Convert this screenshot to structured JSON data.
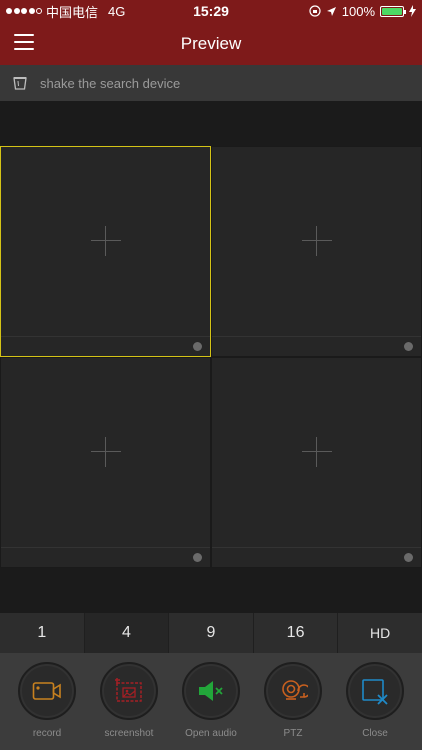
{
  "status_bar": {
    "carrier": "中国电信",
    "network": "4G",
    "time": "15:29",
    "battery": "100%"
  },
  "nav": {
    "title": "Preview"
  },
  "search": {
    "label": "shake the search device"
  },
  "layouts": [
    {
      "label": "1"
    },
    {
      "label": "4"
    },
    {
      "label": "9"
    },
    {
      "label": "16"
    },
    {
      "label": "HD"
    }
  ],
  "toolbar": {
    "record": "record",
    "screenshot": "screenshot",
    "open_audio": "Open audio",
    "ptz": "PTZ",
    "close": "Close"
  },
  "colors": {
    "header": "#7e1a1a",
    "selected_border": "#d4c316",
    "record": "#c8811f",
    "screenshot": "#a41f24",
    "audio": "#22a63a",
    "ptz": "#c8601f",
    "close": "#1f8ac8",
    "battery": "#4cd964"
  }
}
